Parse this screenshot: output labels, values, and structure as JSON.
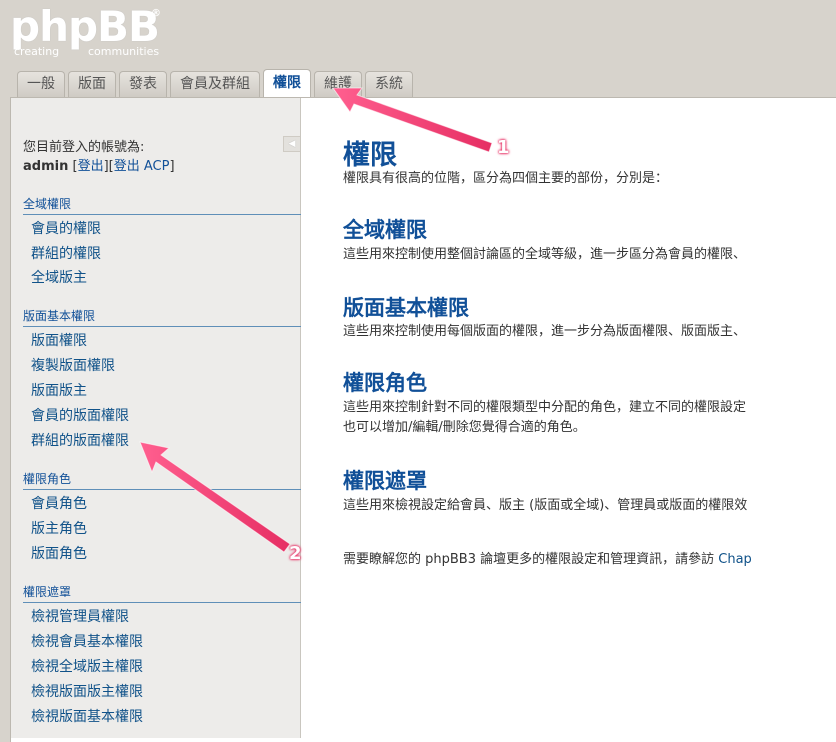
{
  "logo": {
    "main": "phpBB",
    "reg": "®",
    "sub_left": "creating",
    "sub_right": "communities"
  },
  "tabs": [
    {
      "label": "一般",
      "active": false
    },
    {
      "label": "版面",
      "active": false
    },
    {
      "label": "發表",
      "active": false
    },
    {
      "label": "會員及群組",
      "active": false
    },
    {
      "label": "權限",
      "active": true
    },
    {
      "label": "維護",
      "active": false
    },
    {
      "label": "系統",
      "active": false
    }
  ],
  "sidebar": {
    "login_label": "您目前登入的帳號為:",
    "username": "admin",
    "bracket_open": "[",
    "logout": "登出",
    "bracket_mid": "][",
    "logout_acp": "登出 ACP",
    "bracket_close": "]",
    "collapse_icon": "◀",
    "sections": [
      {
        "title": "全域權限",
        "items": [
          "會員的權限",
          "群組的權限",
          "全域版主"
        ]
      },
      {
        "title": "版面基本權限",
        "items": [
          "版面權限",
          "複製版面權限",
          "版面版主",
          "會員的版面權限",
          "群組的版面權限"
        ]
      },
      {
        "title": "權限角色",
        "items": [
          "會員角色",
          "版主角色",
          "版面角色"
        ]
      },
      {
        "title": "權限遮罩",
        "items": [
          "檢視管理員權限",
          "檢視會員基本權限",
          "檢視全域版主權限",
          "檢視版面版主權限",
          "檢視版面基本權限"
        ]
      }
    ]
  },
  "content": {
    "title": "權限",
    "intro": "權限具有很高的位階，區分為四個主要的部份，分別是：",
    "blocks": [
      {
        "heading": "全域權限",
        "lines": [
          "這些用來控制使用整個討論區的全域等級，進一步區分為會員的權限、"
        ]
      },
      {
        "heading": "版面基本權限",
        "lines": [
          "這些用來控制使用每個版面的權限，進一步分為版面權限、版面版主、"
        ]
      },
      {
        "heading": "權限角色",
        "lines": [
          "這些用來控制針對不同的權限類型中分配的角色，建立不同的權限設定",
          "也可以增加/編輯/刪除您覺得合適的角色。"
        ]
      },
      {
        "heading": "權限遮罩",
        "lines": [
          "這些用來檢視設定給會員、版主 (版面或全域)、管理員或版面的權限效"
        ]
      }
    ],
    "footer_text": "需要瞭解您的 phpBB3 論壇更多的權限設定和管理資訊，請參訪 ",
    "footer_link": "Chap"
  },
  "annotations": {
    "badge1": "1",
    "badge2": "2",
    "color": "#ee3f73"
  }
}
